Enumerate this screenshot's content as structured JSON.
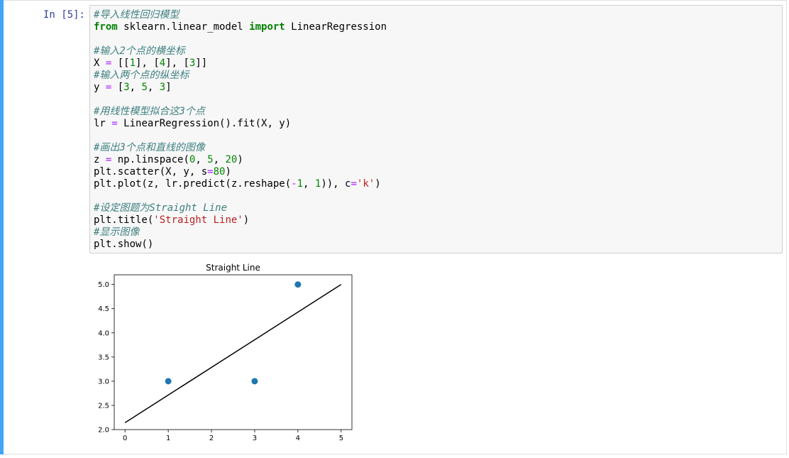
{
  "cell": {
    "prompt": "In [5]:",
    "code_lines": [
      [
        {
          "t": "#导入线性回归模型",
          "c": "cm"
        }
      ],
      [
        {
          "t": "from",
          "c": "kw"
        },
        {
          "t": " sklearn.linear_model ",
          "c": ""
        },
        {
          "t": "import",
          "c": "kw"
        },
        {
          "t": " LinearRegression",
          "c": ""
        }
      ],
      [],
      [
        {
          "t": "#输入2个点的横坐标",
          "c": "cm"
        }
      ],
      [
        {
          "t": "X ",
          "c": ""
        },
        {
          "t": "=",
          "c": "op"
        },
        {
          "t": " [[",
          "c": ""
        },
        {
          "t": "1",
          "c": "num"
        },
        {
          "t": "], [",
          "c": ""
        },
        {
          "t": "4",
          "c": "num"
        },
        {
          "t": "], [",
          "c": ""
        },
        {
          "t": "3",
          "c": "num"
        },
        {
          "t": "]]",
          "c": ""
        }
      ],
      [
        {
          "t": "#输入两个点的纵坐标",
          "c": "cm"
        }
      ],
      [
        {
          "t": "y ",
          "c": ""
        },
        {
          "t": "=",
          "c": "op"
        },
        {
          "t": " [",
          "c": ""
        },
        {
          "t": "3",
          "c": "num"
        },
        {
          "t": ", ",
          "c": ""
        },
        {
          "t": "5",
          "c": "num"
        },
        {
          "t": ", ",
          "c": ""
        },
        {
          "t": "3",
          "c": "num"
        },
        {
          "t": "]",
          "c": ""
        }
      ],
      [],
      [
        {
          "t": "#用线性模型拟合这3个点",
          "c": "cm"
        }
      ],
      [
        {
          "t": "lr ",
          "c": ""
        },
        {
          "t": "=",
          "c": "op"
        },
        {
          "t": " LinearRegression().fit(X, y)",
          "c": ""
        }
      ],
      [],
      [
        {
          "t": "#画出3个点和直线的图像",
          "c": "cm"
        }
      ],
      [
        {
          "t": "z ",
          "c": ""
        },
        {
          "t": "=",
          "c": "op"
        },
        {
          "t": " np.linspace(",
          "c": ""
        },
        {
          "t": "0",
          "c": "num"
        },
        {
          "t": ", ",
          "c": ""
        },
        {
          "t": "5",
          "c": "num"
        },
        {
          "t": ", ",
          "c": ""
        },
        {
          "t": "20",
          "c": "num"
        },
        {
          "t": ")",
          "c": ""
        }
      ],
      [
        {
          "t": "plt.scatter(X, y, s",
          "c": ""
        },
        {
          "t": "=",
          "c": "op"
        },
        {
          "t": "80",
          "c": "num"
        },
        {
          "t": ")",
          "c": ""
        }
      ],
      [
        {
          "t": "plt.plot(z, lr.predict(z.reshape(",
          "c": ""
        },
        {
          "t": "-",
          "c": "op"
        },
        {
          "t": "1",
          "c": "num"
        },
        {
          "t": ", ",
          "c": ""
        },
        {
          "t": "1",
          "c": "num"
        },
        {
          "t": ")), c",
          "c": ""
        },
        {
          "t": "=",
          "c": "op"
        },
        {
          "t": "'k'",
          "c": "str"
        },
        {
          "t": ")",
          "c": ""
        }
      ],
      [],
      [
        {
          "t": "#设定图题为Straight Line",
          "c": "cm"
        }
      ],
      [
        {
          "t": "plt.title(",
          "c": ""
        },
        {
          "t": "'Straight Line'",
          "c": "str"
        },
        {
          "t": ")",
          "c": ""
        }
      ],
      [
        {
          "t": "#显示图像",
          "c": "cm"
        }
      ],
      [
        {
          "t": "plt.show()",
          "c": ""
        }
      ]
    ]
  },
  "chart_data": {
    "type": "scatter",
    "title": "Straight Line",
    "xlabel": "",
    "ylabel": "",
    "xlim": [
      -0.25,
      5.25
    ],
    "ylim": [
      2.0,
      5.2
    ],
    "xticks": [
      0,
      1,
      2,
      3,
      4,
      5
    ],
    "yticks": [
      2.0,
      2.5,
      3.0,
      3.5,
      4.0,
      4.5,
      5.0
    ],
    "ytick_labels": [
      "2.0",
      "2.5",
      "3.0",
      "3.5",
      "4.0",
      "4.5",
      "5.0"
    ],
    "grid": false,
    "legend": "none",
    "points": [
      {
        "x": 1,
        "y": 3
      },
      {
        "x": 4,
        "y": 5
      },
      {
        "x": 3,
        "y": 3
      }
    ],
    "line": {
      "x": [
        0,
        5
      ],
      "y": [
        2.1429,
        5.0
      ]
    },
    "colors": {
      "points": "#1f77b4",
      "line": "#000000"
    }
  }
}
